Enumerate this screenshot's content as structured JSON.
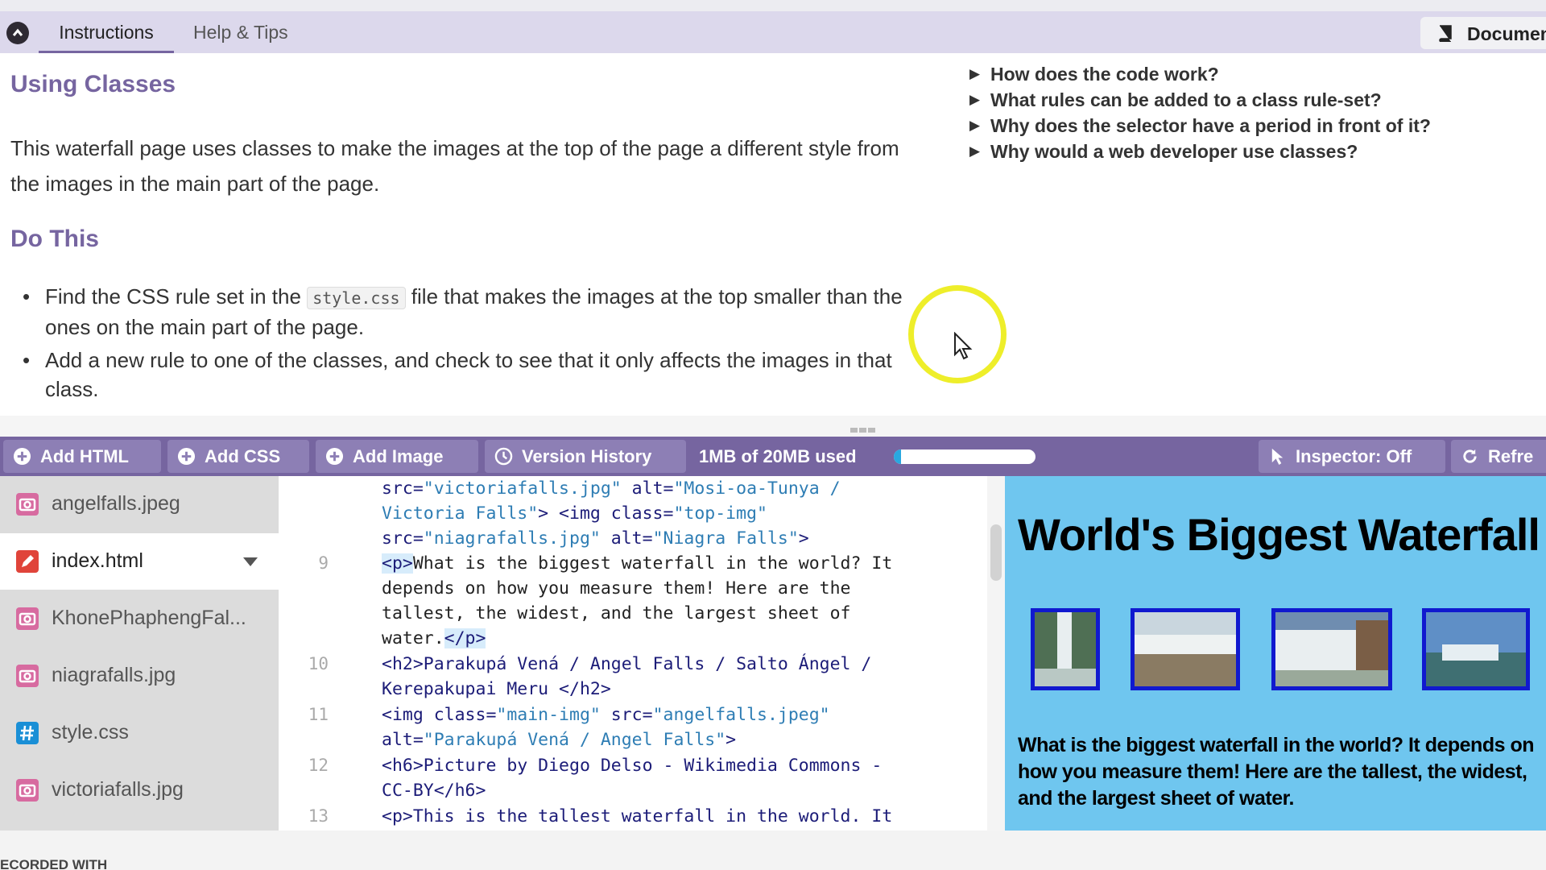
{
  "tabs": {
    "instructions": "Instructions",
    "help": "Help & Tips",
    "documentation": "Documen"
  },
  "instructions": {
    "heading1": "Using Classes",
    "paragraph": "This waterfall page uses classes to make the images at the top of the page a different style from the images in the main part of the page.",
    "heading2": "Do This",
    "bullet1_pre": "Find the CSS rule set in the",
    "bullet1_code": "style.css",
    "bullet1_post": "file that makes the images at the top smaller than the ones on the main part of the page.",
    "bullet2": "Add a new rule to one of the classes, and check to see that it only affects the images in that class."
  },
  "faq": [
    "How does the code work?",
    "What rules can be added to a class rule-set?",
    "Why does the selector have a period in front of it?",
    "Why would a web developer use classes?"
  ],
  "toolbar": {
    "add_html": "Add HTML",
    "add_css": "Add CSS",
    "add_image": "Add Image",
    "version_history": "Version History",
    "usage": "1MB of 20MB used",
    "usage_fraction": 0.05,
    "inspector": "Inspector: Off",
    "refresh": "Refre"
  },
  "files": [
    {
      "name": "angelfalls.jpeg",
      "type": "image"
    },
    {
      "name": "index.html",
      "type": "html",
      "active": true
    },
    {
      "name": "KhonePhaphengFal...",
      "type": "image"
    },
    {
      "name": "niagrafalls.jpg",
      "type": "image"
    },
    {
      "name": "style.css",
      "type": "css"
    },
    {
      "name": "victoriafalls.jpg",
      "type": "image"
    }
  ],
  "code": {
    "line_numbers": [
      "9",
      "10",
      "11",
      "12",
      "13"
    ],
    "l1_a": "src=",
    "l1_b": "\"victoriafalls.jpg\"",
    "l1_c": " alt=",
    "l1_d": "\"Mosi-oa-Tunya /",
    "l2_a": "Victoria Falls\"",
    "l2_b": "> <img class=",
    "l2_c": "\"top-img\"",
    "l3_a": "src=",
    "l3_b": "\"niagrafalls.jpg\"",
    "l3_c": " alt=",
    "l3_d": "\"Niagra Falls\"",
    "l3_e": ">",
    "l4_a": "<p>",
    "l4_b": "What is the biggest waterfall in the world?  It",
    "l5": "depends on how you measure them!  Here are the",
    "l6": "tallest, the widest, and the largest sheet of",
    "l7_a": "water.",
    "l7_b": "</p>",
    "l8": "<h2>Parakupá Vená / Angel Falls / Salto Ángel /",
    "l9": "Kerepakupai Meru </h2>",
    "l10_a": "<img class=",
    "l10_b": "\"main-img\"",
    "l10_c": " src=",
    "l10_d": "\"angelfalls.jpeg\"",
    "l11_a": "alt=",
    "l11_b": "\"Parakupá Vená / Angel Falls\"",
    "l11_c": ">",
    "l12": "<h6>Picture by Diego Delso - Wikimedia Commons -",
    "l13": "CC-BY</h6>",
    "l14": "<p>This is the tallest waterfall in the world.  It"
  },
  "preview": {
    "title": "World's Biggest Waterfall",
    "text": "What is the biggest waterfall in the world? It depends on how you measure them! Here are the tallest, the widest, and the largest sheet of water."
  },
  "watermark": "ECORDED WITH",
  "colors": {
    "accent": "#7665a0",
    "toolbar_button": "#8d7fb5",
    "preview_bg": "#6fc6ef",
    "thumb_border": "#1019cf",
    "image_file_icon": "#d76ba0",
    "html_file_icon": "#e0443a",
    "css_file_icon": "#1a8fd6"
  }
}
